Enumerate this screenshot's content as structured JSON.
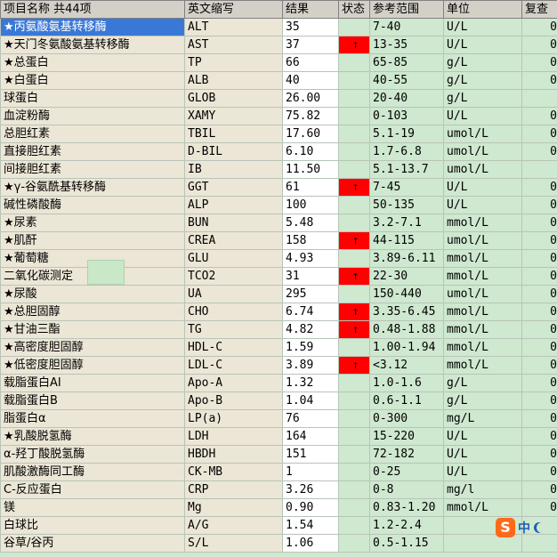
{
  "header": {
    "name": "项目名称 共44项",
    "abbr": "英文缩写",
    "result": "结果",
    "status": "状态",
    "range": "参考范围",
    "unit": "单位",
    "review": "复查"
  },
  "rows": [
    {
      "name": "★丙氨酸氨基转移酶",
      "abbr": "ALT",
      "result": "35",
      "status": "",
      "range": "7-40",
      "unit": "U/L",
      "review": "0",
      "selected": true
    },
    {
      "name": "★天门冬氨酸氨基转移酶",
      "abbr": "AST",
      "result": "37",
      "status": "↑",
      "range": "13-35",
      "unit": "U/L",
      "review": "0"
    },
    {
      "name": "★总蛋白",
      "abbr": "TP",
      "result": "66",
      "status": "",
      "range": "65-85",
      "unit": "g/L",
      "review": "0"
    },
    {
      "name": "★白蛋白",
      "abbr": "ALB",
      "result": "40",
      "status": "",
      "range": "40-55",
      "unit": "g/L",
      "review": "0"
    },
    {
      "name": "球蛋白",
      "abbr": "GLOB",
      "result": "26.00",
      "status": "",
      "range": "20-40",
      "unit": "g/L",
      "review": ""
    },
    {
      "name": "血淀粉酶",
      "abbr": "XAMY",
      "result": "75.82",
      "status": "",
      "range": "0-103",
      "unit": "U/L",
      "review": "0"
    },
    {
      "name": "总胆红素",
      "abbr": "TBIL",
      "result": "17.60",
      "status": "",
      "range": "5.1-19",
      "unit": "umol/L",
      "review": "0"
    },
    {
      "name": "直接胆红素",
      "abbr": "D-BIL",
      "result": "6.10",
      "status": "",
      "range": "1.7-6.8",
      "unit": "umol/L",
      "review": "0"
    },
    {
      "name": "间接胆红素",
      "abbr": "IB",
      "result": "11.50",
      "status": "",
      "range": "5.1-13.7",
      "unit": "umol/L",
      "review": ""
    },
    {
      "name": "★γ-谷氨酰基转移酶",
      "abbr": "GGT",
      "result": "61",
      "status": "↑",
      "range": "7-45",
      "unit": "U/L",
      "review": "0"
    },
    {
      "name": "碱性磷酸酶",
      "abbr": "ALP",
      "result": "100",
      "status": "",
      "range": "50-135",
      "unit": "U/L",
      "review": "0"
    },
    {
      "name": "★尿素",
      "abbr": "BUN",
      "result": "5.48",
      "status": "",
      "range": "3.2-7.1",
      "unit": "mmol/L",
      "review": "0"
    },
    {
      "name": "★肌酐",
      "abbr": "CREA",
      "result": "158",
      "status": "↑",
      "range": "44-115",
      "unit": "umol/L",
      "review": "0"
    },
    {
      "name": "★葡萄糖",
      "abbr": "GLU",
      "result": "4.93",
      "status": "",
      "range": "3.89-6.11",
      "unit": "mmol/L",
      "review": "0"
    },
    {
      "name": "二氧化碳测定",
      "abbr": "TCO2",
      "result": "31",
      "status": "↑",
      "range": "22-30",
      "unit": "mmol/L",
      "review": "0"
    },
    {
      "name": "★尿酸",
      "abbr": "UA",
      "result": "295",
      "status": "",
      "range": "150-440",
      "unit": "umol/L",
      "review": "0"
    },
    {
      "name": "★总胆固醇",
      "abbr": "CHO",
      "result": "6.74",
      "status": "↑",
      "range": "3.35-6.45",
      "unit": "mmol/L",
      "review": "0"
    },
    {
      "name": "★甘油三酯",
      "abbr": "TG",
      "result": "4.82",
      "status": "↑",
      "range": "0.48-1.88",
      "unit": "mmol/L",
      "review": "0"
    },
    {
      "name": "★高密度胆固醇",
      "abbr": "HDL-C",
      "result": "1.59",
      "status": "",
      "range": "1.00-1.94",
      "unit": "mmol/L",
      "review": "0"
    },
    {
      "name": "★低密度胆固醇",
      "abbr": "LDL-C",
      "result": "3.89",
      "status": "↑",
      "range": "<3.12",
      "unit": "mmol/L",
      "review": "0"
    },
    {
      "name": "载脂蛋白AⅠ",
      "abbr": "Apo-A",
      "result": "1.32",
      "status": "",
      "range": "1.0-1.6",
      "unit": "g/L",
      "review": "0"
    },
    {
      "name": "载脂蛋白B",
      "abbr": "Apo-B",
      "result": "1.04",
      "status": "",
      "range": "0.6-1.1",
      "unit": "g/L",
      "review": "0"
    },
    {
      "name": "脂蛋白α",
      "abbr": "LP(a)",
      "result": "76",
      "status": "",
      "range": "0-300",
      "unit": "mg/L",
      "review": "0"
    },
    {
      "name": "★乳酸脱氢酶",
      "abbr": "LDH",
      "result": "164",
      "status": "",
      "range": "15-220",
      "unit": "U/L",
      "review": "0"
    },
    {
      "name": "α-羟丁酸脱氢酶",
      "abbr": "HBDH",
      "result": "151",
      "status": "",
      "range": "72-182",
      "unit": "U/L",
      "review": "0"
    },
    {
      "name": "肌酸激酶同工酶",
      "abbr": "CK-MB",
      "result": "1",
      "status": "",
      "range": "0-25",
      "unit": "U/L",
      "review": "0"
    },
    {
      "name": "C-反应蛋白",
      "abbr": "CRP",
      "result": "3.26",
      "status": "",
      "range": "0-8",
      "unit": "mg/l",
      "review": "0"
    },
    {
      "name": "镁",
      "abbr": "Mg",
      "result": "0.90",
      "status": "",
      "range": "0.83-1.20",
      "unit": "mmol/L",
      "review": "0"
    },
    {
      "name": "白球比",
      "abbr": "A/G",
      "result": "1.54",
      "status": "",
      "range": "1.2-2.4",
      "unit": "",
      "review": ""
    },
    {
      "name": "谷草/谷丙",
      "abbr": "S/L",
      "result": "1.06",
      "status": "",
      "range": "0.5-1.15",
      "unit": "",
      "review": ""
    }
  ],
  "ime": {
    "logo": "S",
    "lang": "中"
  },
  "colors": {
    "high_flag": "#ff0000",
    "selected": "#3a78d8",
    "grid_bg": "#cfe8d0",
    "name_bg": "#ece6d6"
  }
}
